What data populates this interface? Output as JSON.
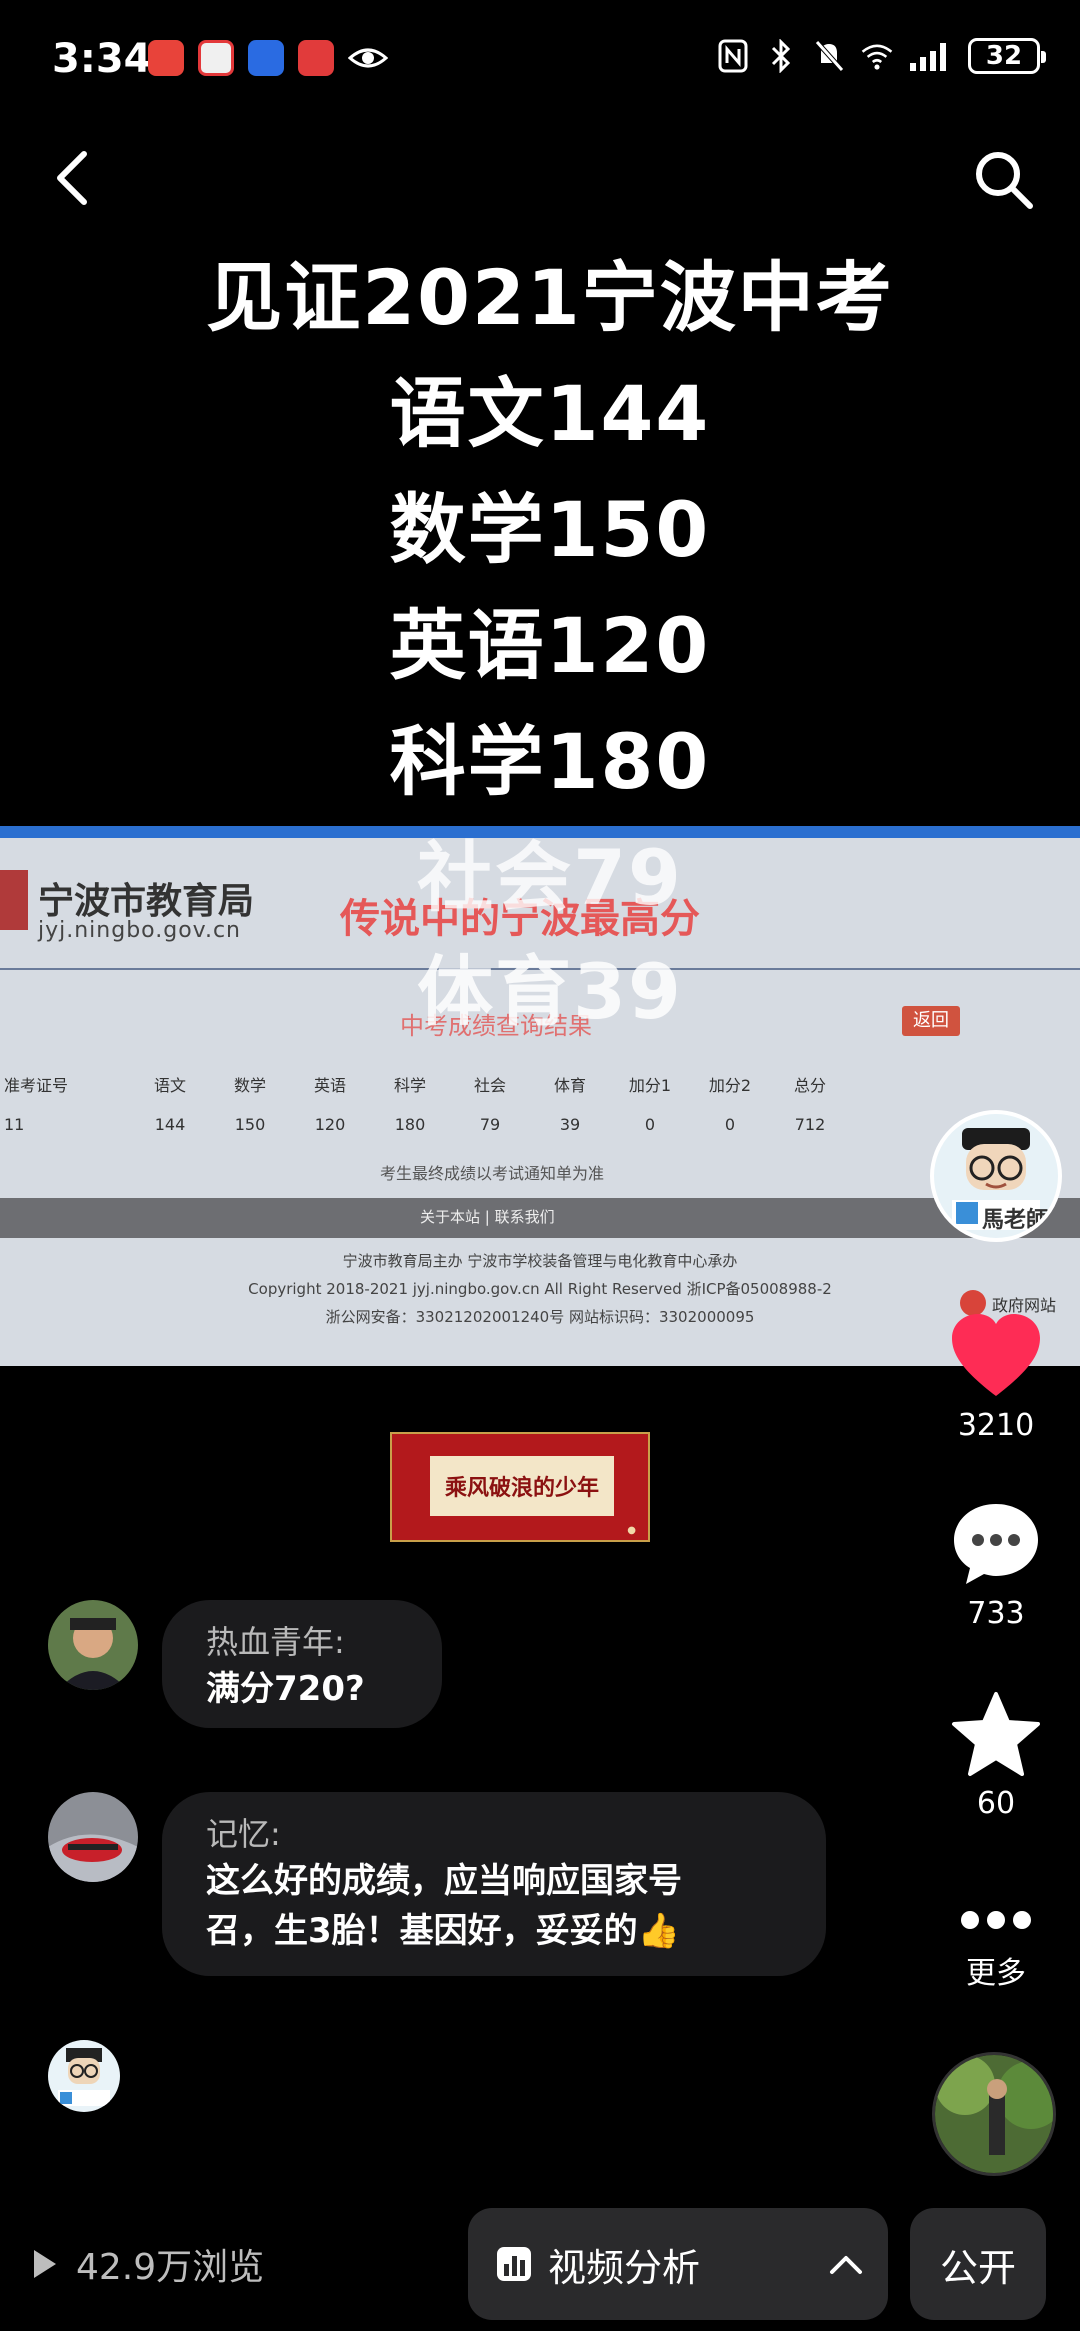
{
  "status_bar": {
    "time": "3:34",
    "battery": "32"
  },
  "overlay_title": {
    "headline": "见证2021宁波中考",
    "lines": [
      "语文144",
      "数学150",
      "英语120",
      "科学180",
      "社会79",
      "体育39"
    ]
  },
  "video_frame": {
    "agency": "宁波市教育局",
    "domain": "jyj.ningbo.gov.cn",
    "caption": "传说中的宁波最高分",
    "result_title": "中考成绩查询结果",
    "back_button": "返回",
    "table": {
      "headers": [
        "准考证号",
        "语文",
        "数学",
        "英语",
        "科学",
        "社会",
        "体育",
        "加分1",
        "加分2",
        "总分"
      ],
      "row": [
        "11",
        "144",
        "150",
        "120",
        "180",
        "79",
        "39",
        "0",
        "0",
        "712"
      ]
    },
    "note": "考生最终成绩以考试通知单为准",
    "footer_links": "关于本站 | 联系我们",
    "footer_lines": [
      "宁波市教育局主办   宁波市学校装备管理与电化教育中心承办",
      "Copyright 2018-2021 jyj.ningbo.gov.cn All Right Reserved   浙ICP备05008988-2",
      "浙公网安备：33021202001240号   网站标识码：3302000095"
    ],
    "sticker": "政府网站"
  },
  "banner": {
    "text": "乘风破浪的少年"
  },
  "comments": [
    {
      "author": "热血青年:",
      "text": "满分720?"
    },
    {
      "author": "记忆:",
      "text_lines": [
        "这么好的成绩，应当响应国家号",
        "召，生3胎！基因好，妥妥的👍"
      ]
    }
  ],
  "rail": {
    "profile_badge": "馬老師",
    "likes": "3210",
    "comments": "733",
    "favorites": "60",
    "more": "更多"
  },
  "bottom_bar": {
    "views": "42.9万浏览",
    "analysis": "视频分析",
    "public": "公开"
  },
  "colors": {
    "like_red": "#fe2c55",
    "bubble_bg": "#1b1b1d",
    "bar_bg": "#2a2a2c"
  }
}
